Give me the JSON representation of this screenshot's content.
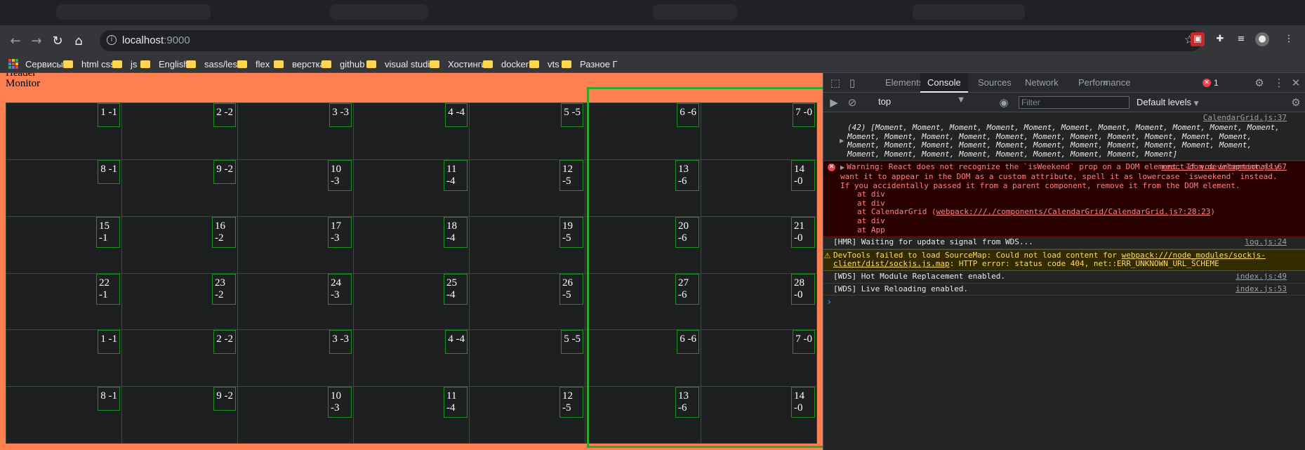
{
  "browser": {
    "url_host": "localhost",
    "url_port": ":9000",
    "bookmarks": [
      {
        "label": "Сервисы",
        "icon": "apps-icon"
      },
      {
        "label": "html css",
        "icon": "folder-icon"
      },
      {
        "label": "js",
        "icon": "folder-icon"
      },
      {
        "label": "English",
        "icon": "folder-icon"
      },
      {
        "label": "sass/less",
        "icon": "folder-icon"
      },
      {
        "label": "flex",
        "icon": "folder-icon"
      },
      {
        "label": "верстка",
        "icon": "folder-icon"
      },
      {
        "label": "github",
        "icon": "folder-icon"
      },
      {
        "label": "visual studio",
        "icon": "folder-icon"
      },
      {
        "label": "Хостинги",
        "icon": "folder-icon"
      },
      {
        "label": "docker",
        "icon": "folder-icon"
      },
      {
        "label": "vts",
        "icon": "folder-icon"
      },
      {
        "label": "Разное Г",
        "icon": "folder-icon"
      }
    ]
  },
  "page": {
    "header": "Header",
    "monitor": "Monitor",
    "cells": [
      "1 -1",
      "2 -2",
      "3 -3",
      "4 -4",
      "5 -5",
      "6 -6",
      "7 -0",
      "8 -1",
      "9 -2",
      "10 -3",
      "11 -4",
      "12 -5",
      "13 -6",
      "14 -0",
      "15 -1",
      "16 -2",
      "17 -3",
      "18 -4",
      "19 -5",
      "20 -6",
      "21 -0",
      "22 -1",
      "23 -2",
      "24 -3",
      "25 -4",
      "26 -5",
      "27 -6",
      "28 -0",
      "1 -1",
      "2 -2",
      "3 -3",
      "4 -4",
      "5 -5",
      "6 -6",
      "7 -0",
      "8 -1",
      "9 -2",
      "10 -3",
      "11 -4",
      "12 -5",
      "13 -6",
      "14 -0"
    ]
  },
  "devtools": {
    "tabs": [
      "Elements",
      "Console",
      "Sources",
      "Network",
      "Performance"
    ],
    "active_tab": "Console",
    "more": "»",
    "error_count": "1",
    "context": "top",
    "filter_placeholder": "Filter",
    "levels": "Default levels",
    "messages": [
      {
        "type": "log",
        "source": "CalendarGrid.js:37",
        "text": "(42) [Moment, Moment, Moment, Moment, Moment, Moment, Moment, Moment, Moment, Moment, Moment, Moment, Moment, Moment, Moment, Moment, Moment, Moment, Moment, Moment, Moment, Moment, Moment, Moment, Moment, Moment, Moment, Moment, Moment, Moment, Moment, Moment, Moment, Moment, Moment, Moment, Moment, Moment, Moment, Moment, Moment, Moment]"
      },
      {
        "type": "error",
        "source": "react-dom.development.js:67",
        "text": "Warning: React does not recognize the `isWeekend` prop on a DOM element. If you intentionally want it to appear in the DOM as a custom attribute, spell it as lowercase `isweekend` instead. If you accidentally passed it from a parent component, remove it from the DOM element.",
        "stack": [
          "at div",
          "at div",
          "at CalendarGrid (",
          "at div",
          "at App"
        ],
        "stack_link": "webpack:///./components/CalendarGrid/CalendarGrid.js?:28:23",
        "stack_close": ")"
      },
      {
        "type": "log",
        "source": "log.js:24",
        "text": "[HMR] Waiting for update signal from WDS..."
      },
      {
        "type": "warn",
        "text_pre": "DevTools failed to load SourceMap: Could not load content for ",
        "link": "webpack:///node_modules/sockjs-client/dist/sockjs.js.map",
        "text_post": ": HTTP error: status code 404, net::ERR_UNKNOWN_URL_SCHEME"
      },
      {
        "type": "log",
        "source": "index.js:49",
        "text": "[WDS] Hot Module Replacement enabled."
      },
      {
        "type": "log",
        "source": "index.js:53",
        "text": "[WDS] Live Reloading enabled."
      }
    ],
    "prompt": "›"
  },
  "colors": {
    "page_bg": "#ff7f50",
    "grid_bg": "#1e1f21",
    "cell_border": "#1f8f1f",
    "highlight": "#2ea82e"
  }
}
